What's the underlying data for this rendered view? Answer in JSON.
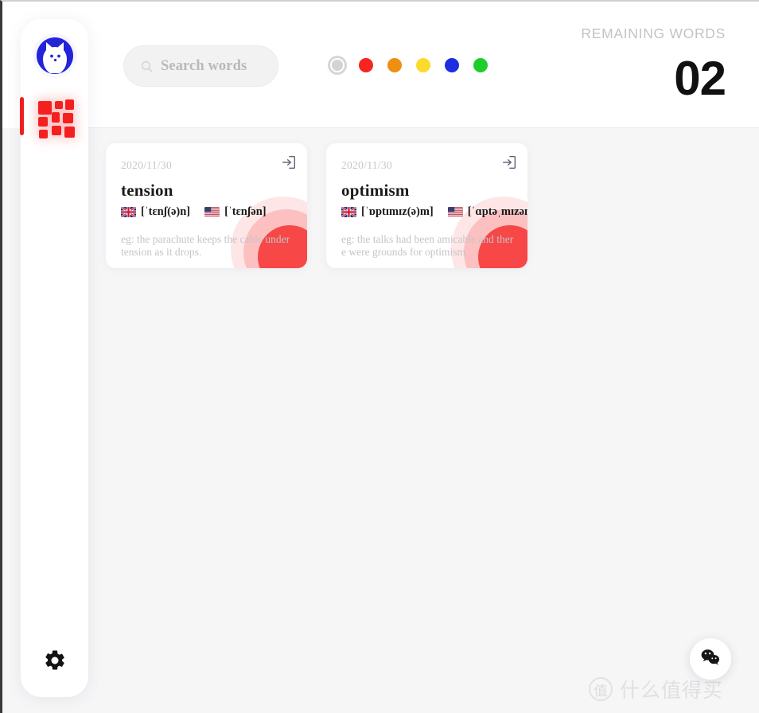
{
  "sidebar": {
    "logo_name": "cat-logo",
    "nav": [
      {
        "id": "dashboard",
        "label": "Dashboard",
        "icon": "grid-icon",
        "active": true
      }
    ],
    "settings_label": "Settings"
  },
  "header": {
    "search": {
      "placeholder": "Search words",
      "value": ""
    },
    "color_filters": [
      {
        "name": "all",
        "color": "#d3d3d5",
        "selected": true
      },
      {
        "name": "red",
        "color": "#f7251f",
        "selected": false
      },
      {
        "name": "orange",
        "color": "#ef8f12",
        "selected": false
      },
      {
        "name": "yellow",
        "color": "#fbda2c",
        "selected": false
      },
      {
        "name": "blue",
        "color": "#1d2ee0",
        "selected": false
      },
      {
        "name": "green",
        "color": "#1ecd2c",
        "selected": false
      }
    ],
    "remaining_label": "REMAINING WORDS",
    "remaining_count": "02"
  },
  "cards": [
    {
      "date": "2020/11/30",
      "word": "tension",
      "uk_flag": "uk-flag",
      "uk_phonetic": "[ˈtɛnʃ(ə)n]",
      "us_flag": "us-flag",
      "us_phonetic": "[ˈtɛnʃən]",
      "example": "eg: the parachute keeps the cable under tension as it drops.",
      "enter_icon": "enter-icon"
    },
    {
      "date": "2020/11/30",
      "word": "optimism",
      "uk_flag": "uk-flag",
      "uk_phonetic": "[ˈɒptɪmɪz(ə)m]",
      "us_flag": "us-flag",
      "us_phonetic": "[ˈɑptəˌmɪzəm]",
      "example": "eg: the talks had been amicable and there were grounds for optimism.",
      "enter_icon": "enter-icon"
    }
  ],
  "floating": {
    "wechat_label": "WeChat"
  },
  "watermark": {
    "badge": "值",
    "text": "什么值得买"
  },
  "colors": {
    "accent_red": "#f42020",
    "logo_blue": "#2323d8",
    "page_bg": "#f6f6f7",
    "card_bg": "#ffffff"
  }
}
